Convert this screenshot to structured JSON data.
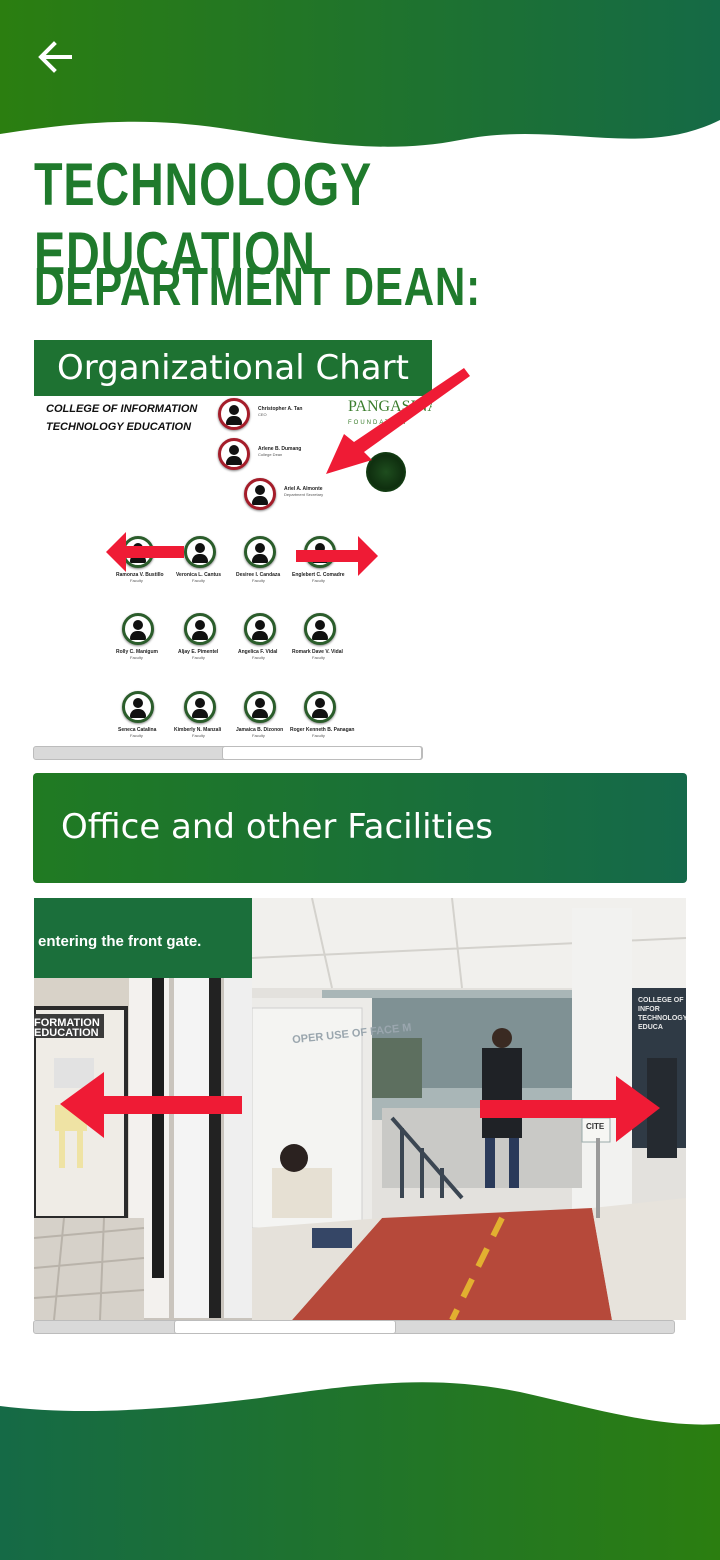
{
  "header": {
    "back_icon": "arrow-left-icon",
    "title_line1": "TECHNOLOGY EDUCATION",
    "title_line2": "DEPARTMENT DEAN:"
  },
  "org_chart": {
    "banner": "Organizational Chart",
    "heading_line1": "COLLEGE OF INFORMATION",
    "heading_line2": "TECHNOLOGY EDUCATION",
    "logo_text": "PANGASINAN",
    "logo_sub": "FOUNDATION",
    "people": [
      {
        "name": "Christopher A. Tan",
        "role": "CEO"
      },
      {
        "name": "Arlene B. Dumang",
        "role": "College Dean"
      },
      {
        "name": "Ariel A. Almonte",
        "role": "Department Secretary"
      },
      {
        "name": "Ramonza V. Bustillo",
        "role": "Faculty"
      },
      {
        "name": "Veronica L. Cantus",
        "role": "Faculty"
      },
      {
        "name": "Desiree I. Candaza",
        "role": "Faculty"
      },
      {
        "name": "Englebert C. Comadre",
        "role": "Faculty"
      },
      {
        "name": "Rolly C. Manigum",
        "role": "Faculty"
      },
      {
        "name": "Aljay E. Pimentel",
        "role": "Faculty"
      },
      {
        "name": "Angelica F. Vidal",
        "role": "Faculty"
      },
      {
        "name": "Romark Dave V. Vidal",
        "role": "Faculty"
      },
      {
        "name": "Seneca Catalina",
        "role": "Faculty"
      },
      {
        "name": "Kimberly N. Manzali",
        "role": "Faculty"
      },
      {
        "name": "Jamaica B. Dizonon",
        "role": "Faculty"
      },
      {
        "name": "Roger Kenneth B. Panagan",
        "role": "Faculty"
      }
    ]
  },
  "facilities": {
    "title": "Office and other Facilities",
    "caption": "r entering the front gate.",
    "sign_text_left": "FORMATION EDUCATION",
    "sign_text_right": "COLLEGE OF INFOR TECHNOLOGY EDUCA",
    "poster_text": "OPER USE OF FACE M",
    "small_sign": "CITE"
  },
  "colors": {
    "brand_green": "#1f7a2c",
    "arrow_red": "#ef1b35"
  }
}
